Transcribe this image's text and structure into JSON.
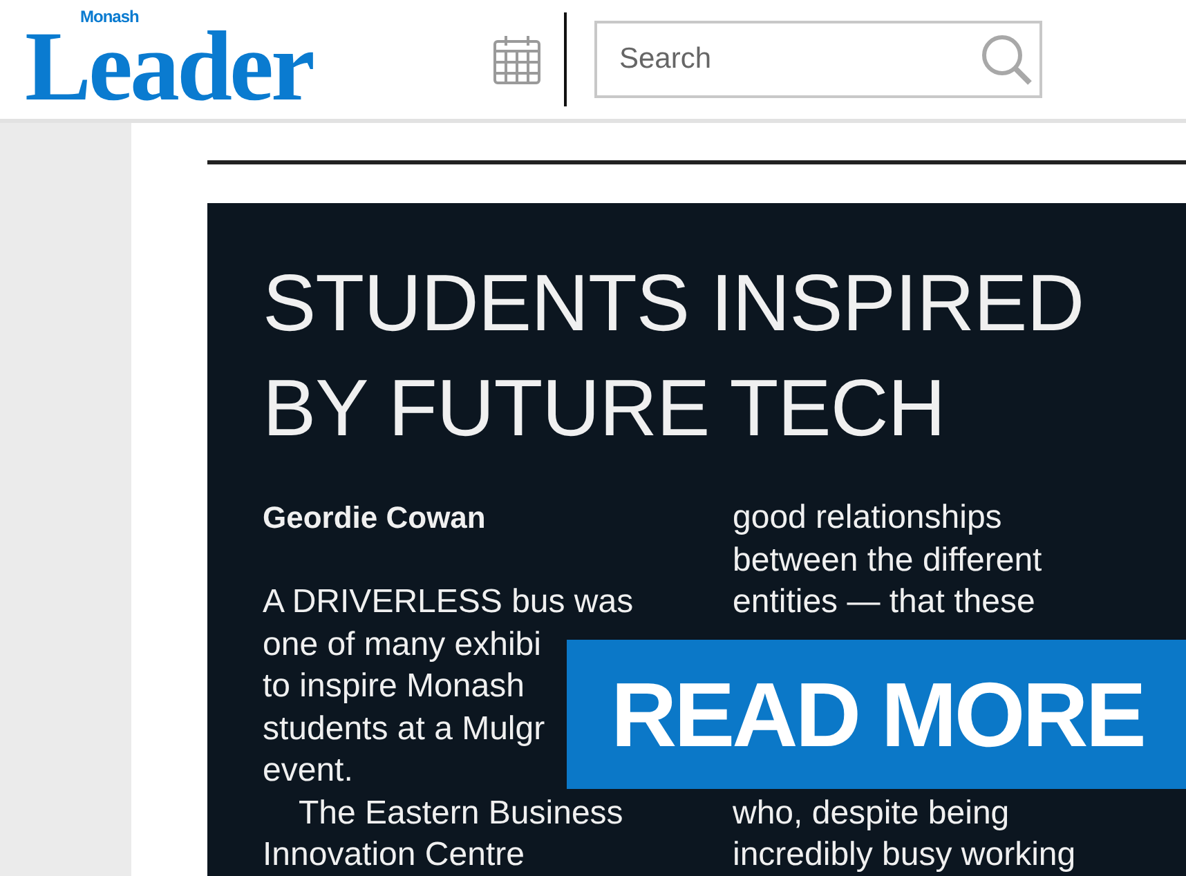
{
  "header": {
    "logo_small": "Monash",
    "logo": "Leader",
    "search": {
      "placeholder": "Search"
    }
  },
  "article": {
    "headline": [
      "STUDENTS INSPIRED",
      "BY FUTURE TECH"
    ],
    "byline": "Geordie Cowan",
    "left_lines": [
      {
        "text": "A DRIVERLESS bus was",
        "indent": false
      },
      {
        "text": "one of many exhibi",
        "indent": false
      },
      {
        "text": "to inspire Monash",
        "indent": false
      },
      {
        "text": "students at a Mulgr",
        "indent": false
      },
      {
        "text": "event.",
        "indent": false
      },
      {
        "text": "The Eastern Business",
        "indent": true
      },
      {
        "text": "Innovation Centre",
        "indent": false
      }
    ],
    "right_top_lines": [
      "good relationships",
      "between the different",
      "entities — that these"
    ],
    "right_bottom_lines": [
      "who, despite being",
      "incredibly busy working"
    ]
  },
  "read_more": "READ MORE"
}
